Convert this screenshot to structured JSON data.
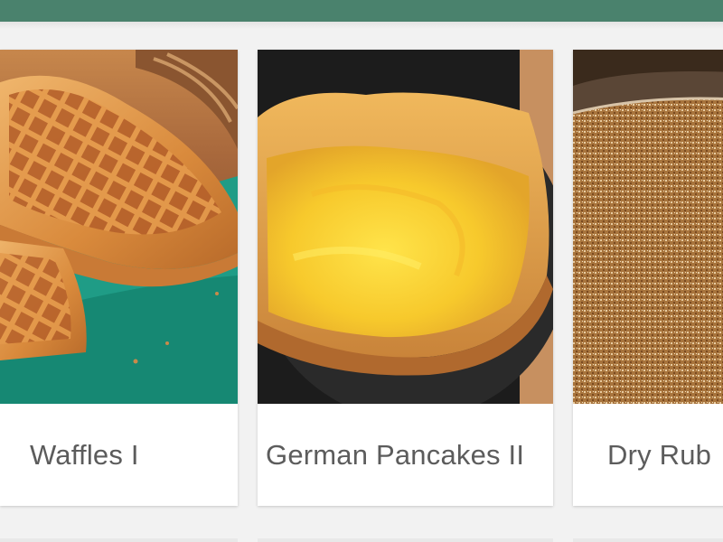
{
  "header": {
    "color": "#4a826d"
  },
  "recipes": [
    {
      "title": "Waffles I",
      "photo_icon": "waffles-photo"
    },
    {
      "title": "German Pancakes II",
      "photo_icon": "german-pancake-photo"
    },
    {
      "title": "Dry Rub",
      "photo_icon": "dry-rub-photo"
    }
  ]
}
